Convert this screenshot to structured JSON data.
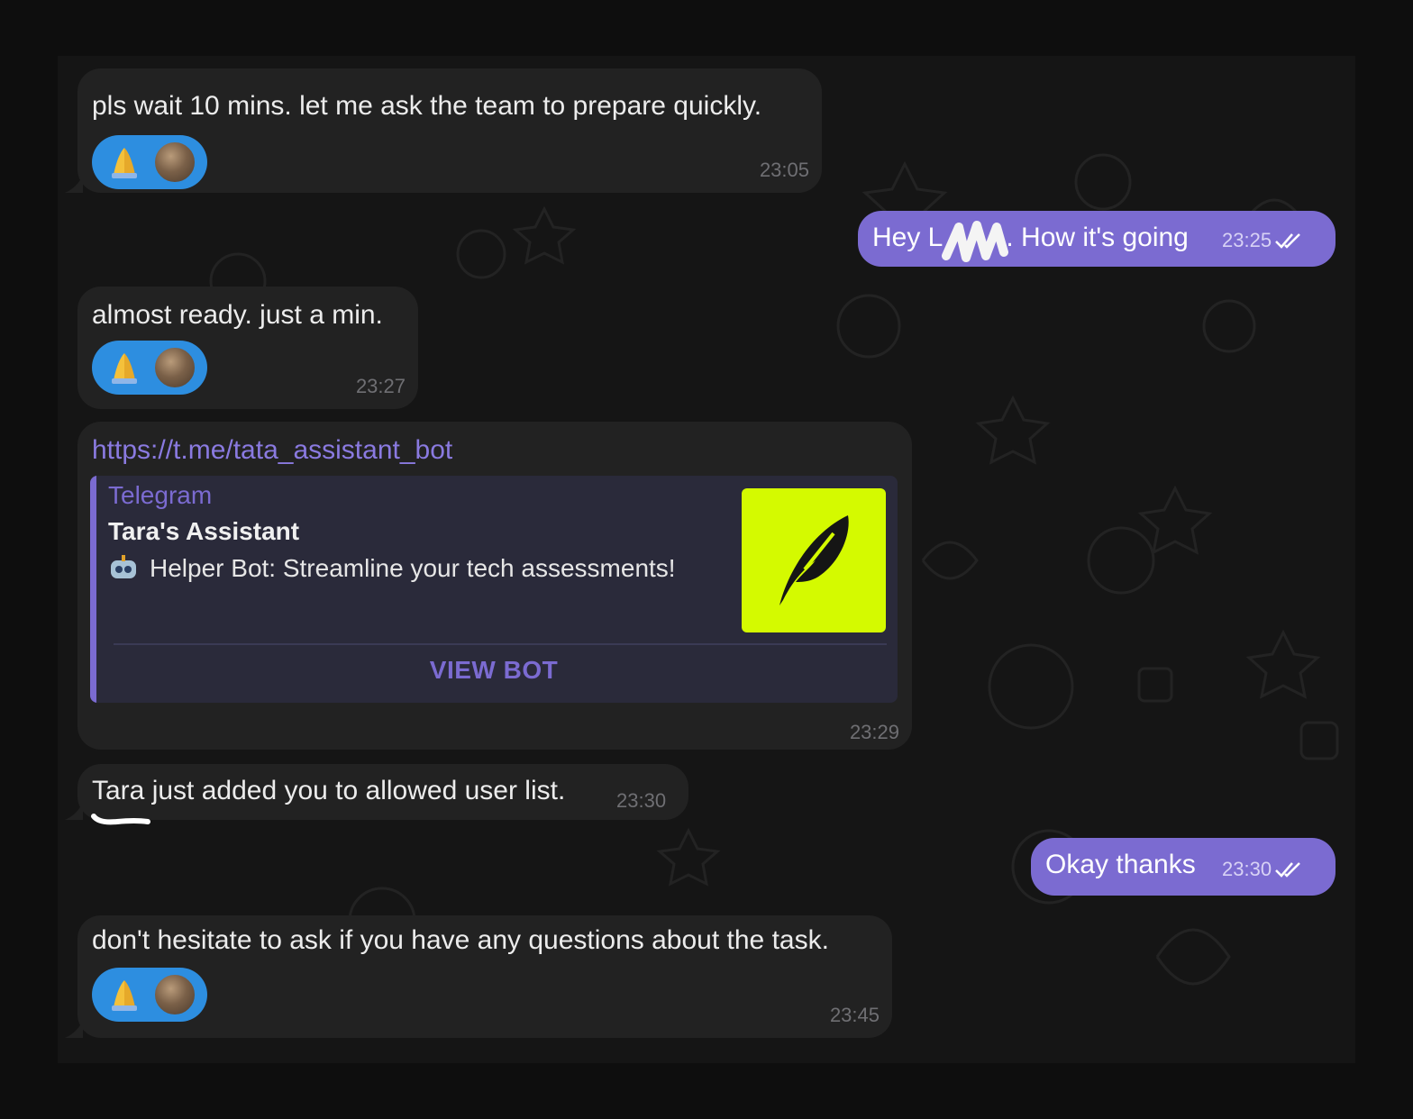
{
  "messages": [
    {
      "text": "pls wait 10 mins. let me ask the team to prepare quickly.",
      "time": "23:05",
      "reaction": "🙏"
    },
    {
      "text": "Hey L",
      "text_after_redaction": ". How it's going",
      "time": "23:25"
    },
    {
      "text": "almost ready. just a min.",
      "time": "23:27",
      "reaction": "🙏"
    },
    {
      "link": "https://t.me/tata_assistant_bot",
      "preview": {
        "site": "Telegram",
        "title": "Tara's Assistant",
        "description": "Helper Bot: Streamline your tech assessments!",
        "button": "VIEW BOT"
      },
      "time": "23:29"
    },
    {
      "text": "Tara just added you to allowed user list.",
      "time": "23:30"
    },
    {
      "text": "Okay thanks",
      "time": "23:30"
    },
    {
      "text": "don't hesitate to ask if you have any questions about the task.",
      "time": "23:45",
      "reaction": "🙏"
    }
  ],
  "colors": {
    "outgoing_bubble": "#7b6bd1",
    "incoming_bubble": "#222222",
    "reaction_pill": "#2d8ee0",
    "preview_image_bg": "#d4fa00"
  },
  "icons": [
    "pray-emoji-icon",
    "reactor-avatar",
    "double-check-icon",
    "robot-icon",
    "feather-logo-icon"
  ]
}
